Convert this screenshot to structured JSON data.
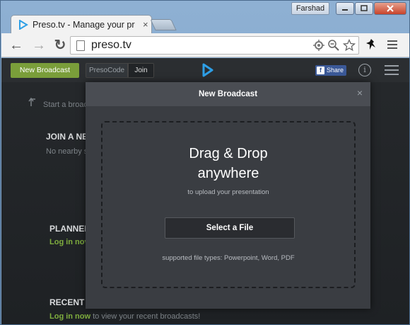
{
  "window": {
    "user_name": "Farshad"
  },
  "tab": {
    "title": "Preso.tv - Manage your pr",
    "close_glyph": "×"
  },
  "toolbar": {
    "url": "preso.tv",
    "back_glyph": "←",
    "forward_glyph": "→",
    "reload_glyph": "↻"
  },
  "app_nav": {
    "new_broadcast": "New Broadcast",
    "presocode": "PresoCode",
    "join": "Join",
    "share_fb": "Share",
    "fb_letter": "f",
    "info": "i"
  },
  "background": {
    "start_text": "Start a broad",
    "join_heading": "JOIN A NE",
    "join_text": "No nearby s",
    "planned_heading": "PLANNEI",
    "planned_link": "Log in nov",
    "recent_heading": "RECENT",
    "recent_link": "Log in now",
    "recent_text": " to view your recent broadcasts!"
  },
  "modal": {
    "title": "New Broadcast",
    "close_glyph": "×",
    "drop_title_line1": "Drag & Drop",
    "drop_title_line2": "anywhere",
    "drop_subtitle": "to upload your presentation",
    "select_button": "Select a File",
    "supported_types": "supported file types: Powerpoint, Word, PDF"
  },
  "colors": {
    "accent_green": "#7a9e3a",
    "facebook_blue": "#3b5998",
    "logo_blue": "#2e9fe6"
  }
}
